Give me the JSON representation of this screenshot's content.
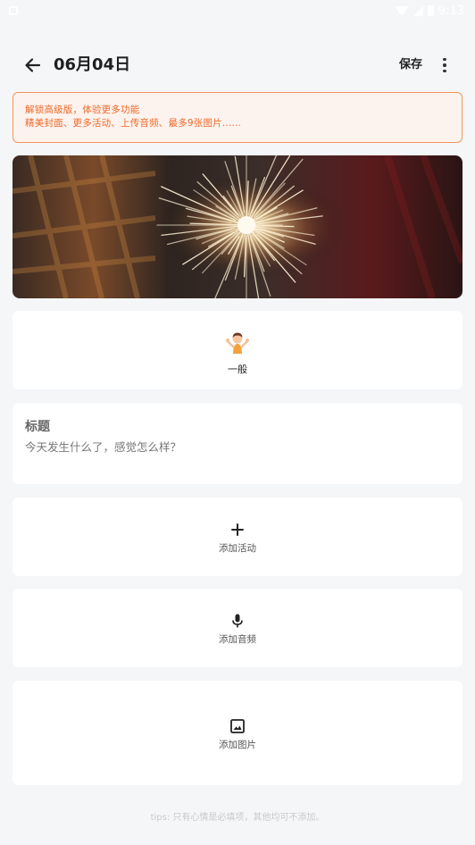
{
  "status_bar": {
    "time": "9:13"
  },
  "header": {
    "date_title": "06月04日",
    "save_label": "保存"
  },
  "promo": {
    "line1": "解锁高级版，体验更多功能",
    "line2": "精美封面、更多活动、上传音频、最多9张图片......"
  },
  "mood": {
    "label": "一般",
    "icon": "person-shrugging-emoji"
  },
  "entry": {
    "title_label": "标题",
    "content_placeholder": "今天发生什么了，感觉怎么样？"
  },
  "actions": {
    "activity_label": "添加活动",
    "audio_label": "添加音频",
    "image_label": "添加图片"
  },
  "tips": "tips: 只有心情是必填项，其他均可不添加。",
  "colors": {
    "accent": "#ee6a2a",
    "background": "#f5f6f8",
    "card": "#ffffff"
  }
}
